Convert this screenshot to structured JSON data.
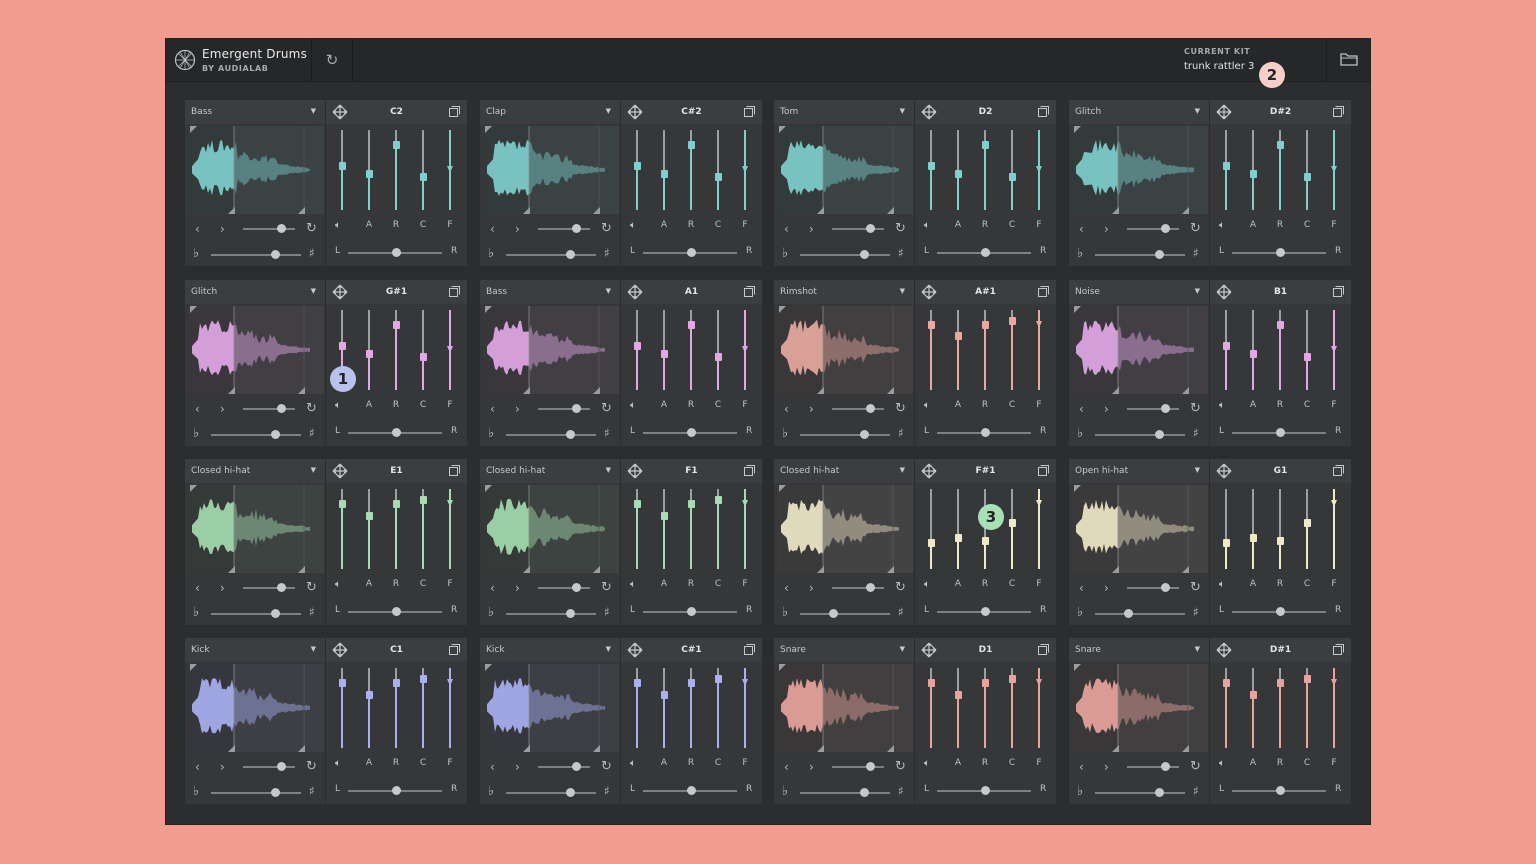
{
  "app": {
    "title": "Emergent Drums",
    "subtitle": "BY AUDIALAB",
    "current_kit_label": "CURRENT KIT",
    "current_kit_name": "trunk rattler 3"
  },
  "badges": [
    "1",
    "2",
    "3"
  ],
  "fader_labels": [
    "A",
    "R",
    "C",
    "F"
  ],
  "pan_left": "L",
  "pan_right": "R",
  "flat_symbol": "♭",
  "sharp_symbol": "♯",
  "icons": {
    "prev": "chevron-left-icon",
    "next": "chevron-right-icon",
    "regenerate": "refresh-icon",
    "volume": "speaker-icon",
    "move": "move-icon",
    "copy": "copy-icon",
    "folder": "folder-icon",
    "dropdown": "caret-down-icon"
  },
  "colors": {
    "teal": "#7fcfcf",
    "pink": "#e2a8e6",
    "rimshot": "#e8a9a0",
    "green": "#a6dcb0",
    "cream": "#efe9c8",
    "lavender": "#a9b0f0",
    "salmon": "#e8a49c",
    "background": "#f29b8f"
  },
  "cells": [
    {
      "sound": "Bass",
      "note": "C2",
      "color": "teal",
      "faders": [
        0.55,
        0.45,
        0.85,
        0.4,
        0.5
      ]
    },
    {
      "sound": "Clap",
      "note": "C#2",
      "color": "teal",
      "faders": [
        0.55,
        0.45,
        0.85,
        0.4,
        0.5
      ]
    },
    {
      "sound": "Tom",
      "note": "D2",
      "color": "teal",
      "faders": [
        0.55,
        0.45,
        0.85,
        0.4,
        0.5
      ]
    },
    {
      "sound": "Glitch",
      "note": "D#2",
      "color": "teal",
      "faders": [
        0.55,
        0.45,
        0.85,
        0.4,
        0.5
      ]
    },
    {
      "sound": "Glitch",
      "note": "G#1",
      "color": "pink",
      "faders": [
        0.55,
        0.45,
        0.85,
        0.4,
        0.5
      ]
    },
    {
      "sound": "Bass",
      "note": "A1",
      "color": "pink",
      "faders": [
        0.55,
        0.45,
        0.85,
        0.4,
        0.5
      ]
    },
    {
      "sound": "Rimshot",
      "note": "A#1",
      "color": "rimshot",
      "faders": [
        0.85,
        0.7,
        0.85,
        0.9,
        0.85
      ]
    },
    {
      "sound": "Noise",
      "note": "B1",
      "color": "pink",
      "faders": [
        0.55,
        0.45,
        0.85,
        0.4,
        0.5
      ]
    },
    {
      "sound": "Closed hi-hat",
      "note": "E1",
      "color": "green",
      "faders": [
        0.85,
        0.68,
        0.85,
        0.9,
        0.85
      ]
    },
    {
      "sound": "Closed hi-hat",
      "note": "F1",
      "color": "green",
      "faders": [
        0.85,
        0.68,
        0.85,
        0.9,
        0.85
      ]
    },
    {
      "sound": "Closed hi-hat",
      "note": "F#1",
      "color": "cream",
      "faders": [
        0.3,
        0.38,
        0.33,
        0.58,
        0.85
      ]
    },
    {
      "sound": "Open hi-hat",
      "note": "G1",
      "color": "cream",
      "faders": [
        0.3,
        0.38,
        0.33,
        0.58,
        0.85
      ]
    },
    {
      "sound": "Kick",
      "note": "C1",
      "color": "lavender",
      "faders": [
        0.85,
        0.68,
        0.85,
        0.9,
        0.85
      ]
    },
    {
      "sound": "Kick",
      "note": "C#1",
      "color": "lavender",
      "faders": [
        0.85,
        0.68,
        0.85,
        0.9,
        0.85
      ]
    },
    {
      "sound": "Snare",
      "note": "D1",
      "color": "salmon",
      "faders": [
        0.85,
        0.68,
        0.85,
        0.9,
        0.85
      ]
    },
    {
      "sound": "Snare",
      "note": "D#1",
      "color": "salmon",
      "faders": [
        0.85,
        0.68,
        0.85,
        0.9,
        0.85
      ]
    }
  ]
}
